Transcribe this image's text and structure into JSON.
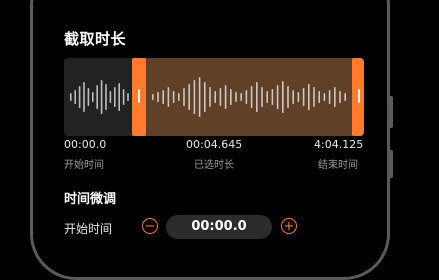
{
  "header": {
    "title": "截取时长"
  },
  "waveform": {
    "accent": "#ff7a2e",
    "bars_unselected": [
      8,
      14,
      22,
      30,
      18,
      10,
      24,
      34,
      26,
      12,
      20,
      28,
      16,
      8
    ],
    "bars_selected": [
      6,
      10,
      14,
      20,
      12,
      8,
      18,
      26,
      34,
      40,
      30,
      20,
      12,
      18,
      24,
      16,
      10,
      8,
      14,
      22,
      30,
      20,
      12,
      16,
      24,
      32,
      22,
      14,
      10,
      18,
      26,
      20,
      12,
      8,
      14,
      20,
      12,
      8
    ]
  },
  "times": {
    "start": {
      "value": "00:00.0",
      "label": "开始时间"
    },
    "selected": {
      "value": "00:04.645",
      "label": "已选时长"
    },
    "end": {
      "value": "4:04.125",
      "label": "结束时间"
    }
  },
  "fine_tune": {
    "title": "时间微调",
    "start_label": "开始时间",
    "start_value": "00:00.0",
    "minus": "−",
    "plus": "+"
  }
}
